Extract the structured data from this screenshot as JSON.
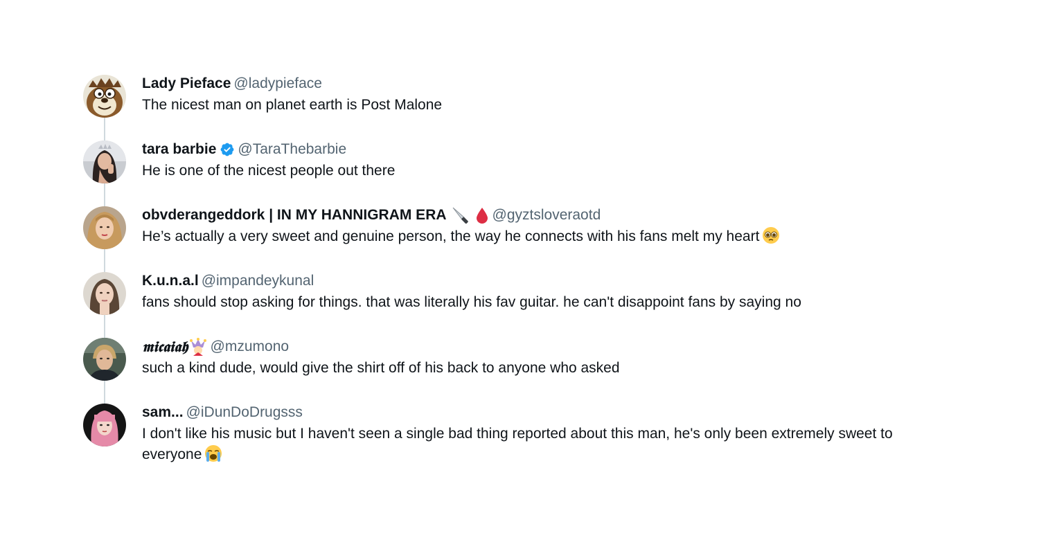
{
  "tweets": [
    {
      "display_name": "Lady Pieface",
      "handle": "@ladypieface",
      "text": "The nicest man on planet earth is Post Malone"
    },
    {
      "display_name": "tara barbie",
      "handle": "@TaraThebarbie",
      "verified": true,
      "text": "He is one of the nicest people out there"
    },
    {
      "display_name": "obvderangeddork | IN MY HANNIGRAM ERA",
      "handle": "@gyztsloveraotd",
      "name_emojis": [
        "knife-icon",
        "drop-of-blood-icon"
      ],
      "text": "He’s actually a very sweet and genuine person, the way he connects with his fans melt my heart",
      "text_emoji": "pleading-face-icon"
    },
    {
      "display_name": "K.u.n.a.l",
      "handle": "@impandeykunal",
      "text": "fans should stop asking for things. that was literally his fav guitar. he can't disappoint fans by saying no"
    },
    {
      "display_name": "𝖒𝖎𝖈𝖆𝖎𝖆𝖍",
      "handle": "@mzumono",
      "name_emojis": [
        "jester-icon"
      ],
      "text": "such a kind dude, would give the shirt off of his back to anyone who asked"
    },
    {
      "display_name": "sam...",
      "handle": "@iDunDoDrugsss",
      "text": "I don't like his music but I haven't seen a single bad thing reported about this man, he's only been extremely sweet to everyone",
      "text_emoji": "loudly-crying-face-icon"
    }
  ],
  "colors": {
    "text": "#0f1419",
    "handle": "#536471",
    "verified": "#1d9bf0",
    "connector": "#cfd9de"
  }
}
